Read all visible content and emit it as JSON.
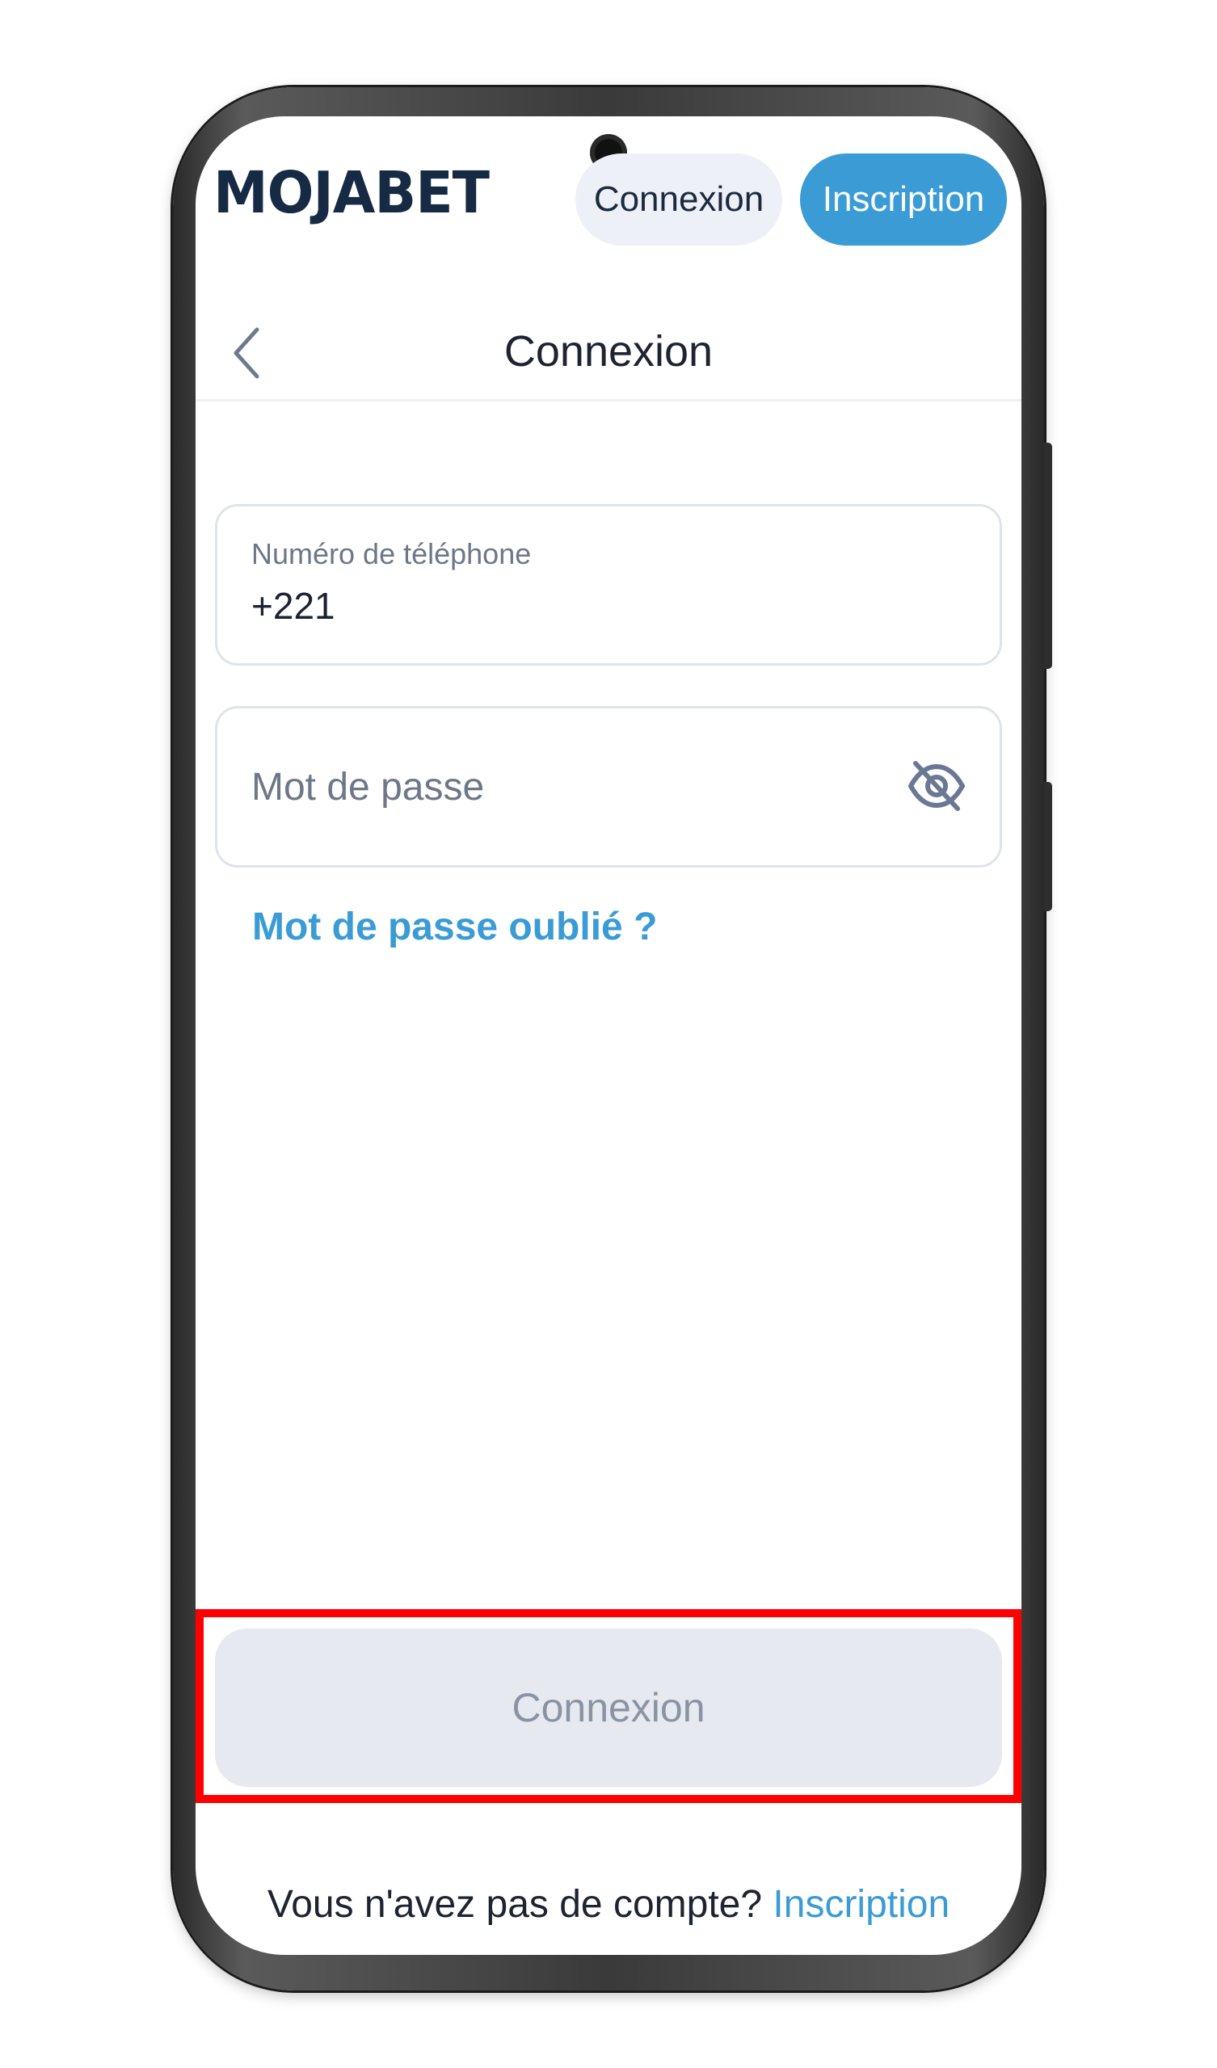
{
  "brand": {
    "logo_text": "MOJABET",
    "logo_color": "#162a44"
  },
  "topbar": {
    "login_label": "Connexion",
    "signup_label": "Inscription"
  },
  "header": {
    "title": "Connexion",
    "back_icon": "chevron-left-icon"
  },
  "form": {
    "phone": {
      "label": "Numéro de téléphone",
      "value": "+221"
    },
    "password": {
      "placeholder": "Mot de passe",
      "toggle_icon": "eye-off-icon"
    },
    "forgot_label": "Mot de passe oublié ?",
    "submit_label": "Connexion"
  },
  "footer": {
    "prompt": "Vous n'avez pas de compte?",
    "link_label": "Inscription"
  },
  "colors": {
    "accent": "#3a9bd5",
    "highlight": "#ff0000",
    "disabled_button": "#e6e9ef"
  }
}
